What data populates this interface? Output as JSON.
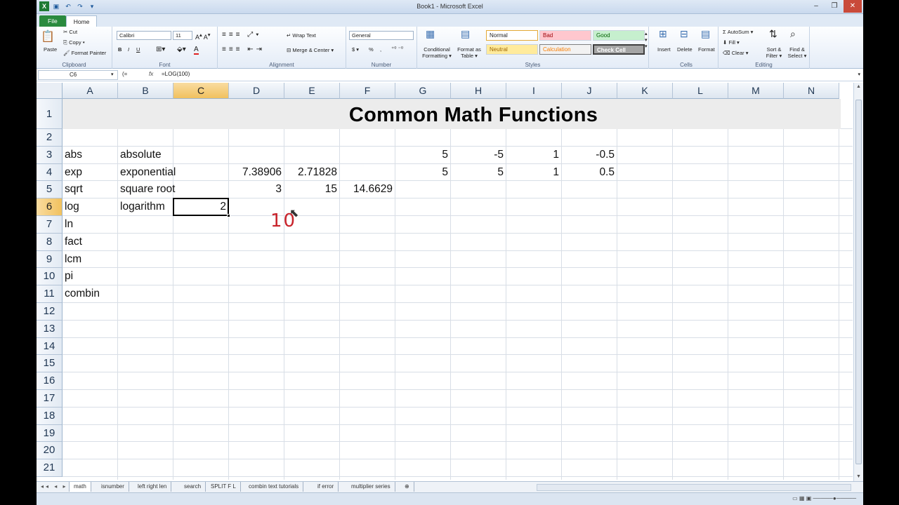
{
  "window": {
    "title": "Book1 - Microsoft Excel"
  },
  "tabs": [
    "File",
    "Home"
  ],
  "ribbon": {
    "clipboard": {
      "label": "Clipboard",
      "paste": "Paste",
      "cut": "Cut",
      "copy": "Copy ▾",
      "format_painter": "Format Painter"
    },
    "font": {
      "label": "Font",
      "name": "Calibri",
      "size": "11",
      "bold": "B",
      "italic": "I",
      "underline": "U"
    },
    "alignment": {
      "label": "Alignment",
      "wrap": "Wrap Text",
      "merge": "Merge & Center ▾"
    },
    "number": {
      "label": "Number",
      "format": "General",
      "currency": "$ ▾",
      "percent": "%",
      "comma": ","
    },
    "styles": {
      "label": "Styles",
      "conditional": "Conditional Formatting ▾",
      "format_table": "Format as Table ▾",
      "normal": "Normal",
      "bad": "Bad",
      "good": "Good",
      "neutral": "Neutral",
      "calculation": "Calculation",
      "check_cell": "Check Cell"
    },
    "cells": {
      "label": "Cells",
      "insert": "Insert",
      "delete": "Delete",
      "format": "Format"
    },
    "editing": {
      "label": "Editing",
      "autosum": "AutoSum ▾",
      "fill": "Fill ▾",
      "clear": "Clear ▾",
      "sort": "Sort & Filter ▾",
      "find": "Find & Select ▾"
    }
  },
  "formula_bar": {
    "name_box": "C6",
    "fx": "fx",
    "formula": "=LOG(100)"
  },
  "columns": [
    "A",
    "B",
    "C",
    "D",
    "E",
    "F",
    "G",
    "H",
    "I",
    "J",
    "K",
    "L",
    "M",
    "N"
  ],
  "rows": [
    "1",
    "2",
    "3",
    "4",
    "5",
    "6",
    "7",
    "8",
    "9",
    "10",
    "11",
    "12",
    "13",
    "14",
    "15",
    "16",
    "17",
    "18",
    "19",
    "20",
    "21"
  ],
  "sheet_title": "Common Math Functions",
  "cells": {
    "A3": "abs",
    "B3": "absolute",
    "G3": "5",
    "H3": "-5",
    "I3": "1",
    "J3": "-0.5",
    "A4": "exp",
    "B4": "exponential",
    "D4": "7.38906",
    "E4": "2.71828",
    "G4": "5",
    "H4": "5",
    "I4": "1",
    "J4": "0.5",
    "A5": "sqrt",
    "B5": "square root",
    "D5": "3",
    "E5": "15",
    "F5": "14.6629",
    "A6": "log",
    "B6": "logarithm",
    "C6": "2",
    "A7": "ln",
    "A8": "fact",
    "A9": "lcm",
    "A10": "pi",
    "A11": "combin"
  },
  "annotation": "10",
  "sheet_tabs": [
    "math",
    "isnumber",
    "left right len",
    "search",
    "SPLIT F L",
    "combin text tutorials",
    "if error",
    "multiplier series"
  ],
  "active_sheet": "math"
}
